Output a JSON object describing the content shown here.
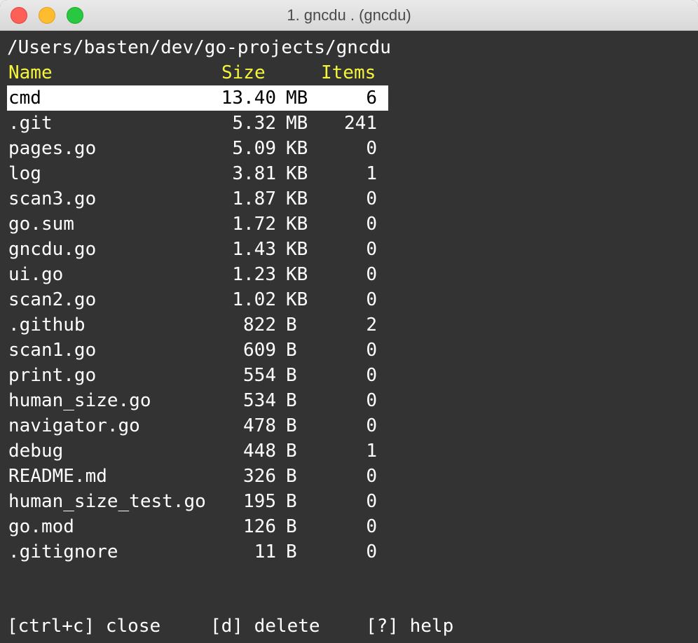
{
  "window": {
    "title": "1. gncdu . (gncdu)"
  },
  "path": "/Users/basten/dev/go-projects/gncdu",
  "header": {
    "name": "Name",
    "size": "Size",
    "items": "Items"
  },
  "rows": [
    {
      "name": "cmd",
      "size": "13.40",
      "unit": "MB",
      "items": "6",
      "selected": true
    },
    {
      "name": ".git",
      "size": "5.32",
      "unit": "MB",
      "items": "241"
    },
    {
      "name": "pages.go",
      "size": "5.09",
      "unit": "KB",
      "items": "0"
    },
    {
      "name": "log",
      "size": "3.81",
      "unit": "KB",
      "items": "1"
    },
    {
      "name": "scan3.go",
      "size": "1.87",
      "unit": "KB",
      "items": "0"
    },
    {
      "name": "go.sum",
      "size": "1.72",
      "unit": "KB",
      "items": "0"
    },
    {
      "name": "gncdu.go",
      "size": "1.43",
      "unit": "KB",
      "items": "0"
    },
    {
      "name": "ui.go",
      "size": "1.23",
      "unit": "KB",
      "items": "0"
    },
    {
      "name": "scan2.go",
      "size": "1.02",
      "unit": "KB",
      "items": "0"
    },
    {
      "name": ".github",
      "size": "822",
      "unit": "B",
      "items": "2"
    },
    {
      "name": "scan1.go",
      "size": "609",
      "unit": "B",
      "items": "0"
    },
    {
      "name": "print.go",
      "size": "554",
      "unit": "B",
      "items": "0"
    },
    {
      "name": "human_size.go",
      "size": "534",
      "unit": "B",
      "items": "0"
    },
    {
      "name": "navigator.go",
      "size": "478",
      "unit": "B",
      "items": "0"
    },
    {
      "name": "debug",
      "size": "448",
      "unit": "B",
      "items": "1"
    },
    {
      "name": "README.md",
      "size": "326",
      "unit": "B",
      "items": "0"
    },
    {
      "name": "human_size_test.go",
      "size": "195",
      "unit": "B",
      "items": "0"
    },
    {
      "name": "go.mod",
      "size": "126",
      "unit": "B",
      "items": "0"
    },
    {
      "name": ".gitignore",
      "size": "11",
      "unit": "B",
      "items": "0"
    }
  ],
  "footer": {
    "close": "[ctrl+c] close",
    "delete": "[d] delete",
    "help": "[?] help"
  },
  "colors": {
    "background": "#333333",
    "header_text": "#f5f53a",
    "selected_bg": "#ffffff",
    "selected_text": "#000000"
  }
}
